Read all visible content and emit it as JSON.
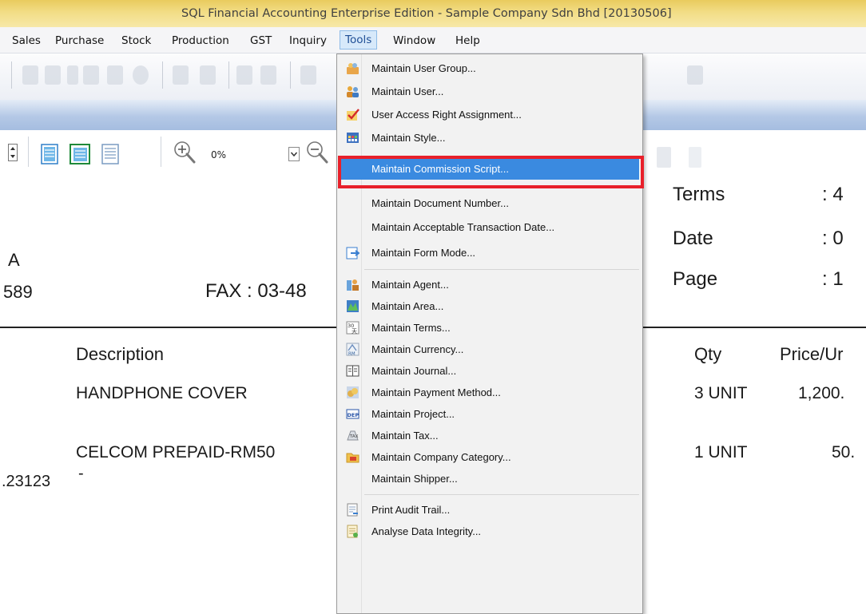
{
  "window": {
    "title": "SQL Financial Accounting Enterprise Edition - Sample Company Sdn Bhd [20130506]"
  },
  "menubar": {
    "items": [
      {
        "label": "Sales"
      },
      {
        "label": "Purchase"
      },
      {
        "label": "Stock"
      },
      {
        "label": "Production"
      },
      {
        "label": "GST"
      },
      {
        "label": "Inquiry"
      },
      {
        "label": "Tools"
      },
      {
        "label": "Window"
      },
      {
        "label": "Help"
      }
    ]
  },
  "preview": {
    "zoom": "0%"
  },
  "document": {
    "left_a": "A",
    "left_phone": "589",
    "fax": "FAX : 03-48",
    "terms_label": "Terms",
    "terms_value": ": 4",
    "date_label": "Date",
    "date_value": ": 0",
    "page_label": "Page",
    "page_value": ": 1",
    "col_description": "Description",
    "col_qty": "Qty",
    "col_price": "Price/Ur",
    "rows": [
      {
        "description": "HANDPHONE COVER",
        "qty": "3 UNIT",
        "price": "1,200."
      },
      {
        "description": "CELCOM PREPAID-RM50",
        "qty": "1 UNIT",
        "price": "50."
      }
    ],
    "serial": ".23123",
    "serial_dash": "-"
  },
  "tools_menu": {
    "items": [
      {
        "label": "Maintain User Group...",
        "icon": "user-group-icon"
      },
      {
        "label": "Maintain User...",
        "icon": "user-icon"
      },
      {
        "label": "User Access Right Assignment...",
        "icon": "check-icon"
      },
      {
        "label": "Maintain Style...",
        "icon": "style-grid-icon"
      },
      {
        "label": "Maintain Commission Script...",
        "icon": ""
      },
      {
        "label": "Maintain Document Number...",
        "icon": ""
      },
      {
        "label": "Maintain Acceptable Transaction Date...",
        "icon": ""
      },
      {
        "label": "Maintain Form Mode...",
        "icon": "form-mode-icon"
      },
      {
        "label": "Maintain Agent...",
        "icon": "agent-icon"
      },
      {
        "label": "Maintain Area...",
        "icon": "area-icon"
      },
      {
        "label": "Maintain Terms...",
        "icon": "terms-icon"
      },
      {
        "label": "Maintain Currency...",
        "icon": "currency-icon"
      },
      {
        "label": "Maintain Journal...",
        "icon": "journal-icon"
      },
      {
        "label": "Maintain Payment Method...",
        "icon": "payment-method-icon"
      },
      {
        "label": "Maintain Project...",
        "icon": "project-icon"
      },
      {
        "label": "Maintain Tax...",
        "icon": "tax-icon"
      },
      {
        "label": "Maintain Company Category...",
        "icon": "company-category-icon"
      },
      {
        "label": "Maintain Shipper...",
        "icon": ""
      },
      {
        "label": "Print Audit Trail...",
        "icon": "audit-trail-icon"
      },
      {
        "label": "Analyse Data Integrity...",
        "icon": "data-integrity-icon"
      }
    ],
    "highlighted_index": 4,
    "accent": "#3a8ae0",
    "callout_color": "#e8202a"
  }
}
